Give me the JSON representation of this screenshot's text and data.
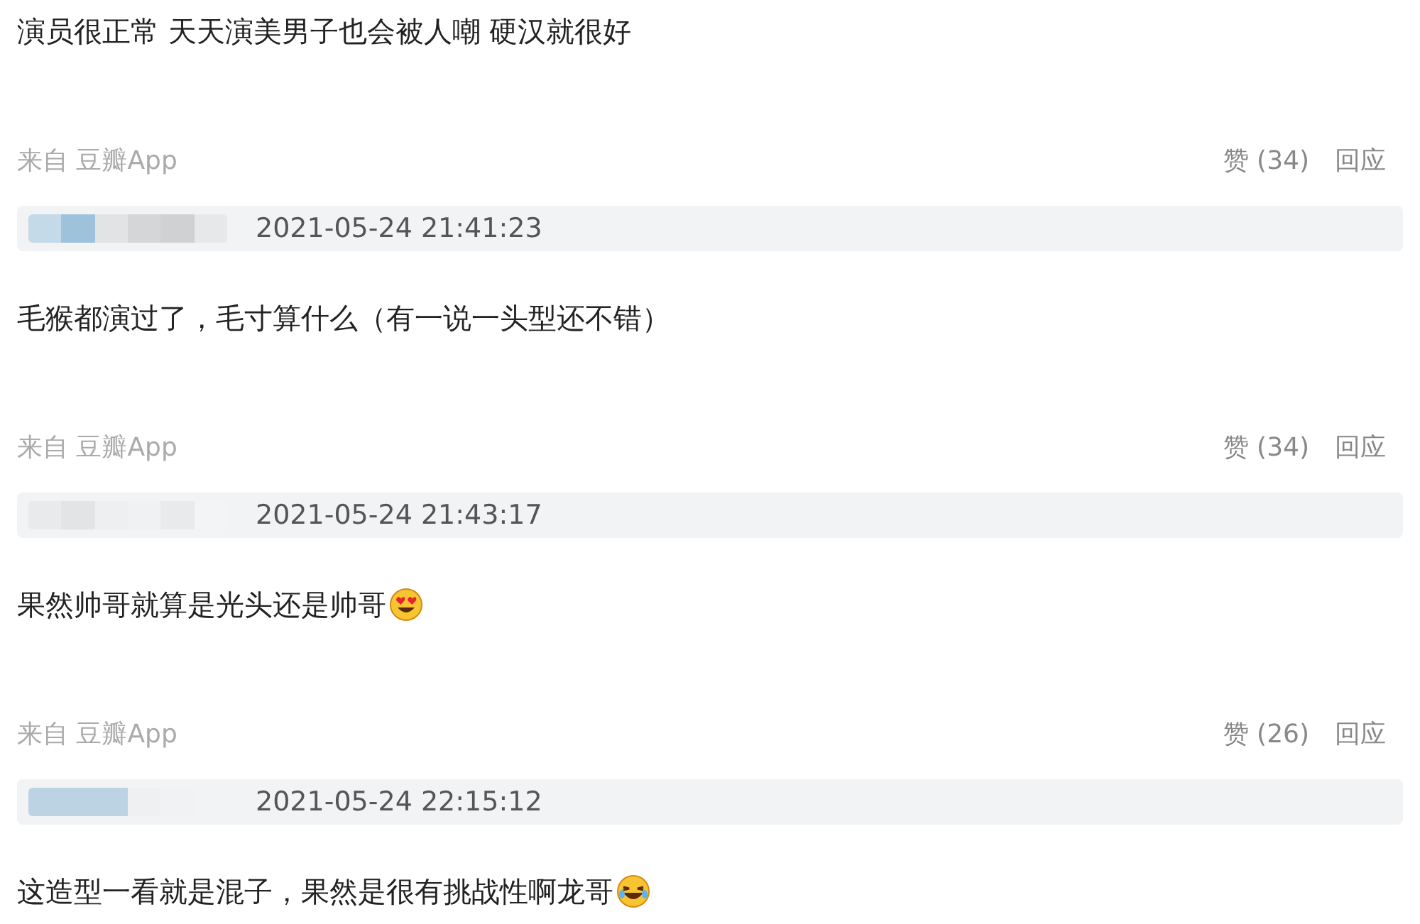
{
  "first_comment": {
    "text": "演员很正常 天天演美男子也会被人嘲 硬汉就很好"
  },
  "comments": [
    {
      "source": "来自 豆瓣App",
      "likes": "赞 (34)",
      "reply": "回应",
      "timestamp": "2021-05-24 21:41:23",
      "text": "毛猴都演过了，毛寸算什么（有一说一头型还不错）",
      "kind": "plain"
    },
    {
      "source": "来自 豆瓣App",
      "likes": "赞 (34)",
      "reply": "回应",
      "timestamp": "2021-05-24 21:43:17",
      "text": "果然帅哥就算是光头还是帅哥",
      "kind": "heart-eyes"
    },
    {
      "source": "来自 豆瓣App",
      "likes": "赞 (26)",
      "reply": "回应",
      "timestamp": "2021-05-24 22:15:12",
      "text": "这造型一看就是混子，果然是很有挑战性啊龙哥",
      "kind": "laughing"
    }
  ]
}
